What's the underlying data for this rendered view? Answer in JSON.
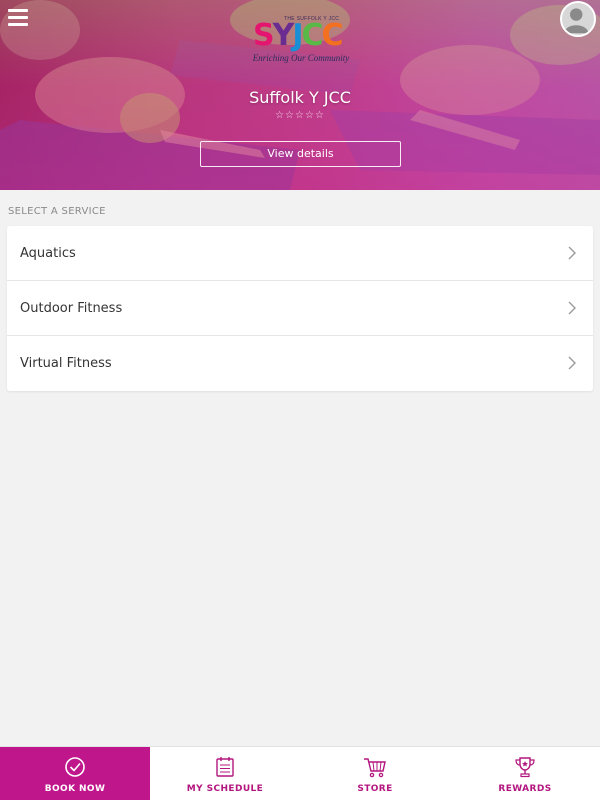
{
  "header": {
    "menu_icon": "hamburger-menu-icon",
    "avatar_icon": "user-avatar-icon",
    "logo": {
      "tagline": "THE SUFFOLK Y JCC",
      "wordmark": [
        "S",
        "Y",
        "J",
        "C",
        "C"
      ],
      "slogan": "Enriching Our Community"
    },
    "title": "Suffolk Y JCC",
    "rating_stars": "☆☆☆☆☆",
    "rating_value": 0,
    "view_details_label": "View details"
  },
  "services": {
    "section_label": "SELECT A SERVICE",
    "items": [
      {
        "label": "Aquatics"
      },
      {
        "label": "Outdoor Fitness"
      },
      {
        "label": "Virtual Fitness"
      }
    ]
  },
  "bottom_nav": {
    "items": [
      {
        "label": "BOOK NOW",
        "icon": "check-circle-icon",
        "active": true
      },
      {
        "label": "MY SCHEDULE",
        "icon": "calendar-icon",
        "active": false
      },
      {
        "label": "STORE",
        "icon": "cart-icon",
        "active": false
      },
      {
        "label": "REWARDS",
        "icon": "trophy-icon",
        "active": false
      }
    ]
  },
  "colors": {
    "brand_magenta": "#c0168c",
    "nav_label": "#b3167f",
    "background": "#f2f2f2"
  }
}
